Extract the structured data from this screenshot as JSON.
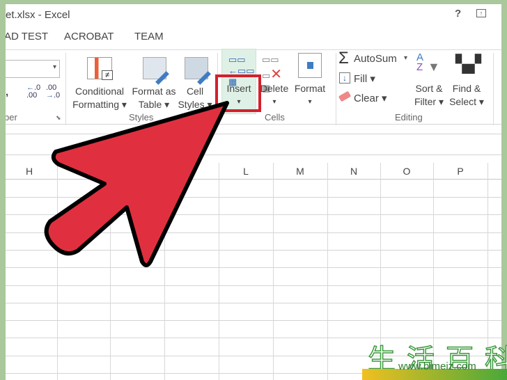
{
  "window": {
    "title": "et.xlsx - Excel",
    "help": "?"
  },
  "tabs": [
    "AD TEST",
    "ACROBAT",
    "TEAM"
  ],
  "ribbon": {
    "number": {
      "comma": ",",
      "inc_decimal": ".00",
      "dec_decimal": ".0",
      "group": "ber"
    },
    "styles": {
      "conditional": [
        "Conditional",
        "Formatting ▾"
      ],
      "format_table": [
        "Format as",
        "Table ▾"
      ],
      "cell_styles": [
        "Cell",
        "Styles ▾"
      ],
      "group": "Styles"
    },
    "cells": {
      "insert": [
        "Insert",
        "▾"
      ],
      "delete": [
        "Delete",
        "▾"
      ],
      "format": [
        "Format",
        "▾"
      ],
      "group": "Cells"
    },
    "editing": {
      "autosum": "AutoSum",
      "autosum_arrow": "▾",
      "fill": "Fill ▾",
      "clear": "Clear ▾",
      "sort": [
        "Sort &",
        "Filter ▾"
      ],
      "find": [
        "Find &",
        "Select ▾"
      ],
      "group": "Editing"
    }
  },
  "columns": [
    "H",
    "L",
    "M",
    "N",
    "O",
    "P"
  ],
  "watermark": {
    "text": "生活百科",
    "url": "www.bimeiz.com"
  },
  "colors": {
    "frame": "#a9c89b",
    "highlight": "#d4202c",
    "arrow": "#e0303f",
    "insert_hover": "#dff0e6"
  }
}
